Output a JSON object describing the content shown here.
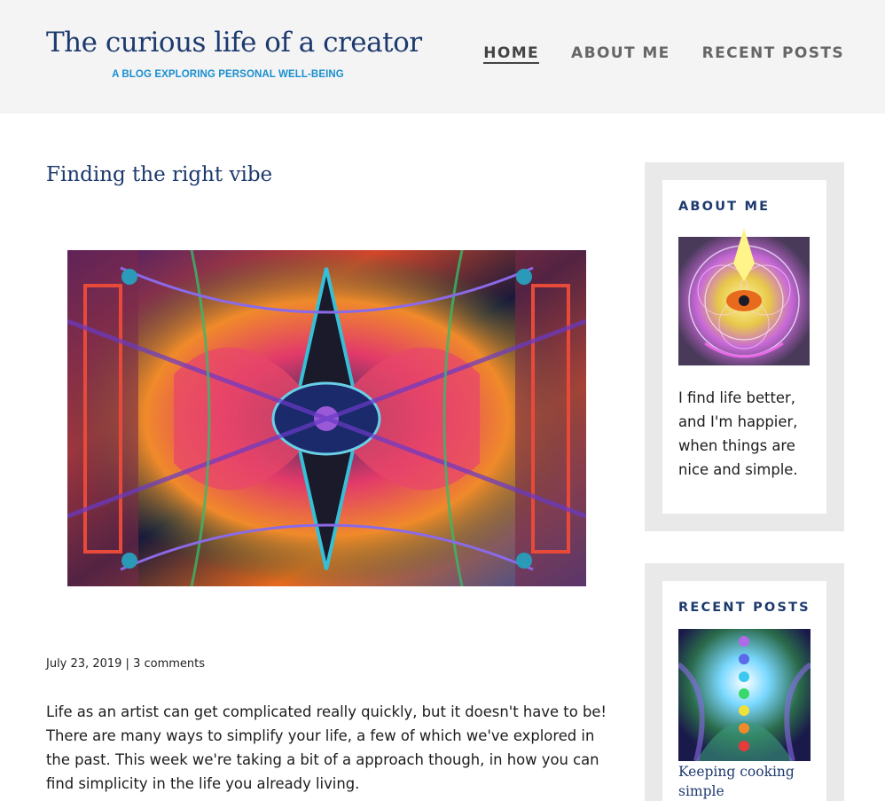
{
  "site": {
    "title": "The curious life of a creator",
    "tagline": "A BLOG EXPLORING PERSONAL WELL-BEING"
  },
  "nav": {
    "items": [
      {
        "label": "HOME",
        "active": true
      },
      {
        "label": "ABOUT ME",
        "active": false
      },
      {
        "label": "RECENT POSTS",
        "active": false
      }
    ]
  },
  "post": {
    "title": "Finding the right vibe",
    "date": "July 23, 2019",
    "separator": "|",
    "comments": "3 comments",
    "excerpt": "Life as an artist can get complicated really quickly, but it doesn't have to be! There are many ways to simplify your life, a few of which we've explored in the past. This week we're taking a bit of a approach though, in how you can find simplicity in the life you already living."
  },
  "sidebar": {
    "about": {
      "title": "ABOUT ME",
      "text": "I find life better, and I'm happier, when things are nice and simple."
    },
    "recent": {
      "title": "RECENT POSTS",
      "post_link": "Keeping cooking simple"
    }
  },
  "colors": {
    "title_navy": "#1d3a6e",
    "tagline_blue": "#1a8fd0",
    "nav_gray": "#666666",
    "header_bg": "#f4f4f4",
    "widget_bg": "#e9e9e9"
  }
}
